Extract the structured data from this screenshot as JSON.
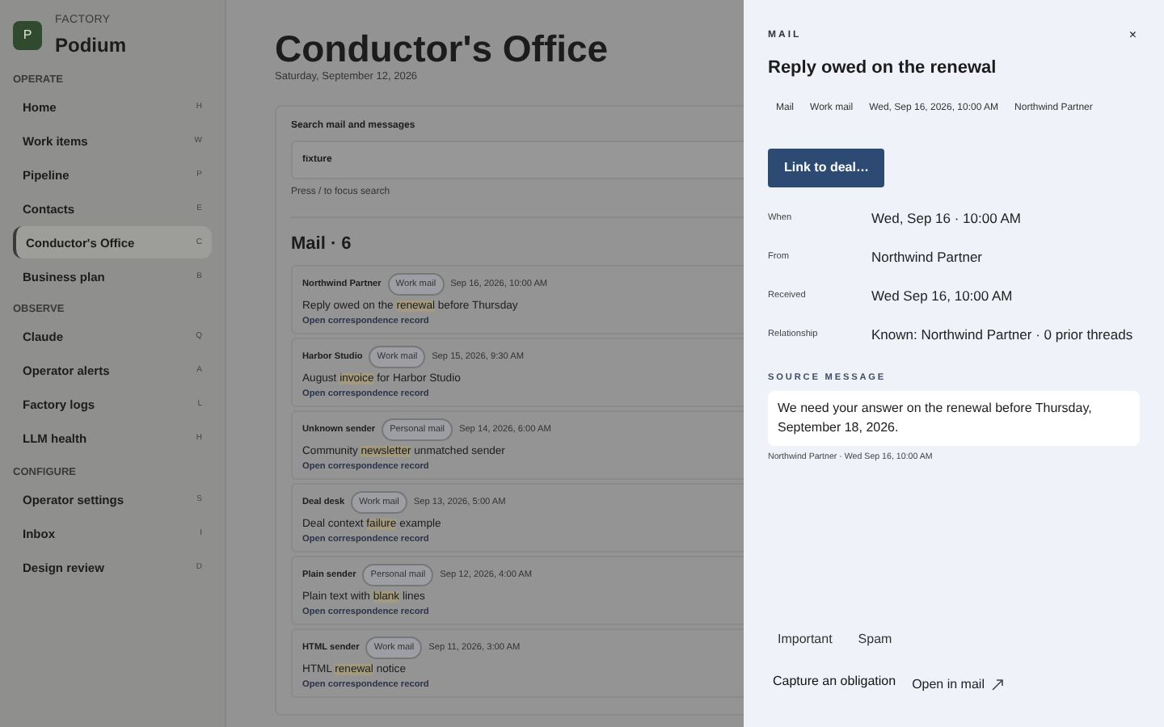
{
  "brand": {
    "logo_letter": "P",
    "eyebrow": "FACTORY",
    "name": "Podium"
  },
  "sidebar": {
    "sections": [
      {
        "title": "OPERATE",
        "items": [
          {
            "label": "Home",
            "key": "H",
            "selected": false
          },
          {
            "label": "Work items",
            "key": "W",
            "selected": false
          },
          {
            "label": "Pipeline",
            "key": "P",
            "selected": false
          },
          {
            "label": "Contacts",
            "key": "E",
            "selected": false
          },
          {
            "label": "Conductor's Office",
            "key": "C",
            "selected": true
          },
          {
            "label": "Business plan",
            "key": "B",
            "selected": false
          }
        ]
      },
      {
        "title": "OBSERVE",
        "items": [
          {
            "label": "Claude",
            "key": "Q",
            "selected": false
          },
          {
            "label": "Operator alerts",
            "key": "A",
            "selected": false
          },
          {
            "label": "Factory logs",
            "key": "L",
            "selected": false
          },
          {
            "label": "LLM health",
            "key": "H",
            "selected": false
          }
        ]
      },
      {
        "title": "CONFIGURE",
        "items": [
          {
            "label": "Operator settings",
            "key": "S",
            "selected": false
          },
          {
            "label": "Inbox",
            "key": "I",
            "selected": false
          },
          {
            "label": "Design review",
            "key": "D",
            "selected": false
          }
        ]
      }
    ]
  },
  "page": {
    "title": "Conductor's Office",
    "date": "Saturday, September 12, 2026"
  },
  "search": {
    "label": "Search mail and messages",
    "value": "fixture",
    "hint": "Press / to focus search"
  },
  "mail": {
    "heading": "Mail · 6",
    "items": [
      {
        "sender": "Northwind Partner",
        "tag": "Work mail",
        "time": "Sep 16, 2026, 10:00 AM",
        "subject": {
          "before": "Reply owed on the ",
          "match": "renewal",
          "after": " before Thursday"
        },
        "link_label": "Open correspondence record"
      },
      {
        "sender": "Harbor Studio",
        "tag": "Work mail",
        "time": "Sep 15, 2026, 9:30 AM",
        "subject": {
          "before": "August ",
          "match": "invoice",
          "after": " for Harbor Studio"
        },
        "link_label": "Open correspondence record"
      },
      {
        "sender": "Unknown sender",
        "tag": "Personal mail",
        "time": "Sep 14, 2026, 6:00 AM",
        "subject": {
          "before": "Community ",
          "match": "newsletter",
          "after": " unmatched sender"
        },
        "link_label": "Open correspondence record"
      },
      {
        "sender": "Deal desk",
        "tag": "Work mail",
        "time": "Sep 13, 2026, 5:00 AM",
        "subject": {
          "before": "Deal context ",
          "match": "failure",
          "after": " example"
        },
        "link_label": "Open correspondence record"
      },
      {
        "sender": "Plain sender",
        "tag": "Personal mail",
        "time": "Sep 12, 2026, 4:00 AM",
        "subject": {
          "before": "Plain text with ",
          "match": "blank",
          "after": " lines"
        },
        "link_label": "Open correspondence record"
      },
      {
        "sender": "HTML sender",
        "tag": "Work mail",
        "time": "Sep 11, 2026, 3:00 AM",
        "subject": {
          "before": "HTML ",
          "match": "renewal",
          "after": " notice"
        },
        "link_label": "Open correspondence record"
      }
    ]
  },
  "drawer": {
    "eyebrow": "MAIL",
    "close": "×",
    "title": "Reply owed on the renewal",
    "chips": [
      "Mail",
      "Work mail",
      "Wed, Sep 16, 2026, 10:00 AM",
      "Northwind Partner"
    ],
    "primary_button": "Link to deal…",
    "fields": [
      {
        "label": "When",
        "value": "Wed, Sep 16 · 10:00 AM"
      },
      {
        "label": "From",
        "value": "Northwind Partner"
      },
      {
        "label": "Received",
        "value": "Wed Sep 16, 10:00 AM"
      },
      {
        "label": "Relationship",
        "value": "Known: Northwind Partner · 0 prior threads"
      }
    ],
    "source_heading": "SOURCE MESSAGE",
    "source_text": "We need your answer on the renewal before Thursday, September 18, 2026.",
    "source_meta": "Northwind Partner · Wed Sep 16, 10:00 AM",
    "flag_buttons": [
      "Important",
      "Spam"
    ],
    "capture_button": "Capture an obligation",
    "open_link": "Open in mail"
  }
}
